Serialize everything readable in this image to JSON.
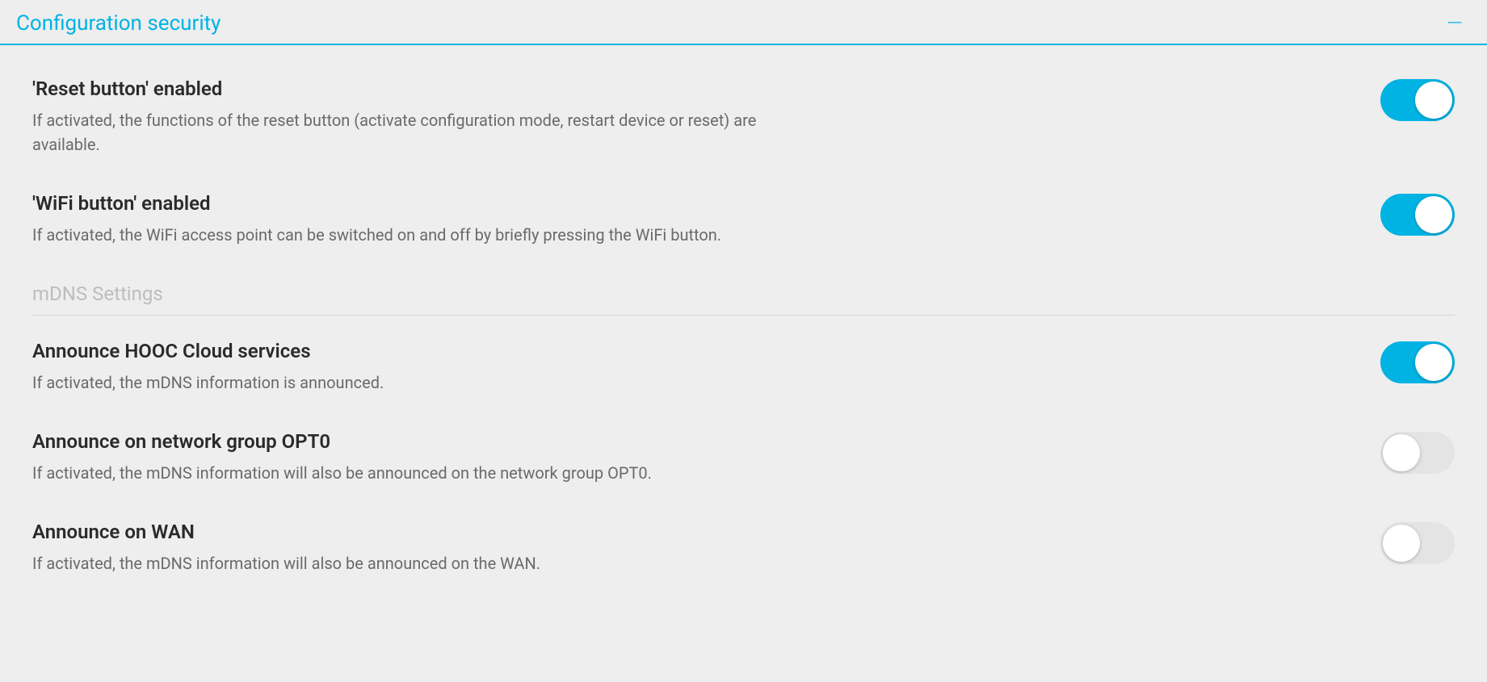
{
  "section": {
    "title": "Configuration security"
  },
  "settings": [
    {
      "label": "'Reset button' enabled",
      "desc": "If activated, the functions of the reset button (activate configuration mode, restart device or reset) are available.",
      "enabled": true
    },
    {
      "label": "'WiFi button' enabled",
      "desc": "If activated, the WiFi access point can be switched on and off by briefly pressing the WiFi button.",
      "enabled": true
    }
  ],
  "subsection": {
    "title": "mDNS Settings"
  },
  "mdns_settings": [
    {
      "label": "Announce HOOC Cloud services",
      "desc": "If activated, the mDNS information is announced.",
      "enabled": true
    },
    {
      "label": "Announce on network group OPT0",
      "desc": "If activated, the mDNS information will also be announced on the network group OPT0.",
      "enabled": false
    },
    {
      "label": "Announce on WAN",
      "desc": "If activated, the mDNS information will also be announced on the WAN.",
      "enabled": false
    }
  ]
}
